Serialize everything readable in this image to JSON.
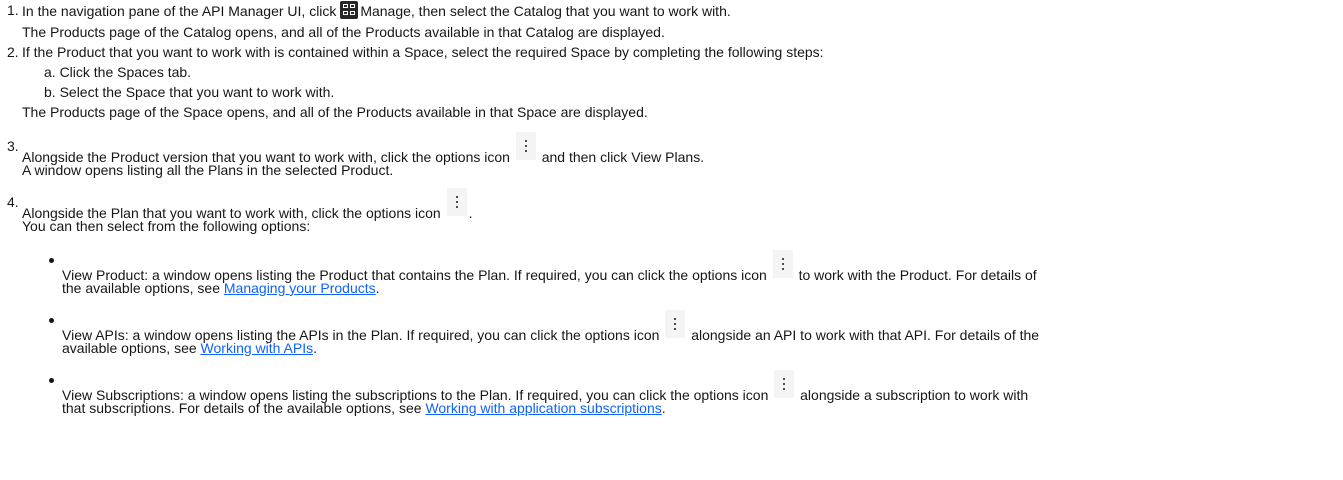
{
  "steps": [
    {
      "num": "1.",
      "line1_before": "In the navigation pane of the API Manager UI, click",
      "line1_after": "Manage, then select the Catalog that you want to work with.",
      "line2": "The Products page of the Catalog opens, and all of the Products available in that Catalog are displayed."
    },
    {
      "num": "2.",
      "line1": "If the Product that you want to work with is contained within a Space, select the required Space by completing the following steps:",
      "sub_a": "a. Click the Spaces tab.",
      "sub_b": "b. Select the Space that you want to work with.",
      "line2": "The Products page of the Space opens, and all of the Products available in that Space are displayed."
    },
    {
      "num": "3.",
      "line1_before": "Alongside the Product version that you want to work with, click the options icon",
      "line1_after": "and then click View Plans.",
      "line2": "A window opens listing all the Plans in the selected Product."
    },
    {
      "num": "4.",
      "line1_before": "Alongside the Plan that you want to work with, click the options icon",
      "line1_after": ".",
      "line2": "You can then select from the following options:"
    }
  ],
  "options": [
    {
      "l1_before": "View Product: a window opens listing the Product that contains the Plan. If required, you can click the options icon",
      "l1_after": "to work with the Product. For details of",
      "l2_before": "the available options, see ",
      "link": "Managing your Products",
      "l2_after": "."
    },
    {
      "l1_before": "View APIs: a window opens listing the APIs in the Plan. If required, you can click the options icon",
      "l1_after": "alongside an API to work with that API. For details of the",
      "l2_before": "available options, see ",
      "link": "Working with APIs",
      "l2_after": "."
    },
    {
      "l1_before": "View Subscriptions: a window opens listing the subscriptions to the Plan. If required, you can click the options icon",
      "l1_after": "alongside a subscription to work with",
      "l2_before": "that subscriptions. For details of the available options, see ",
      "link": "Working with application subscriptions",
      "l2_after": "."
    }
  ],
  "icons": {
    "manage": "manage-grid-icon",
    "options": "overflow-menu-vertical-icon"
  }
}
